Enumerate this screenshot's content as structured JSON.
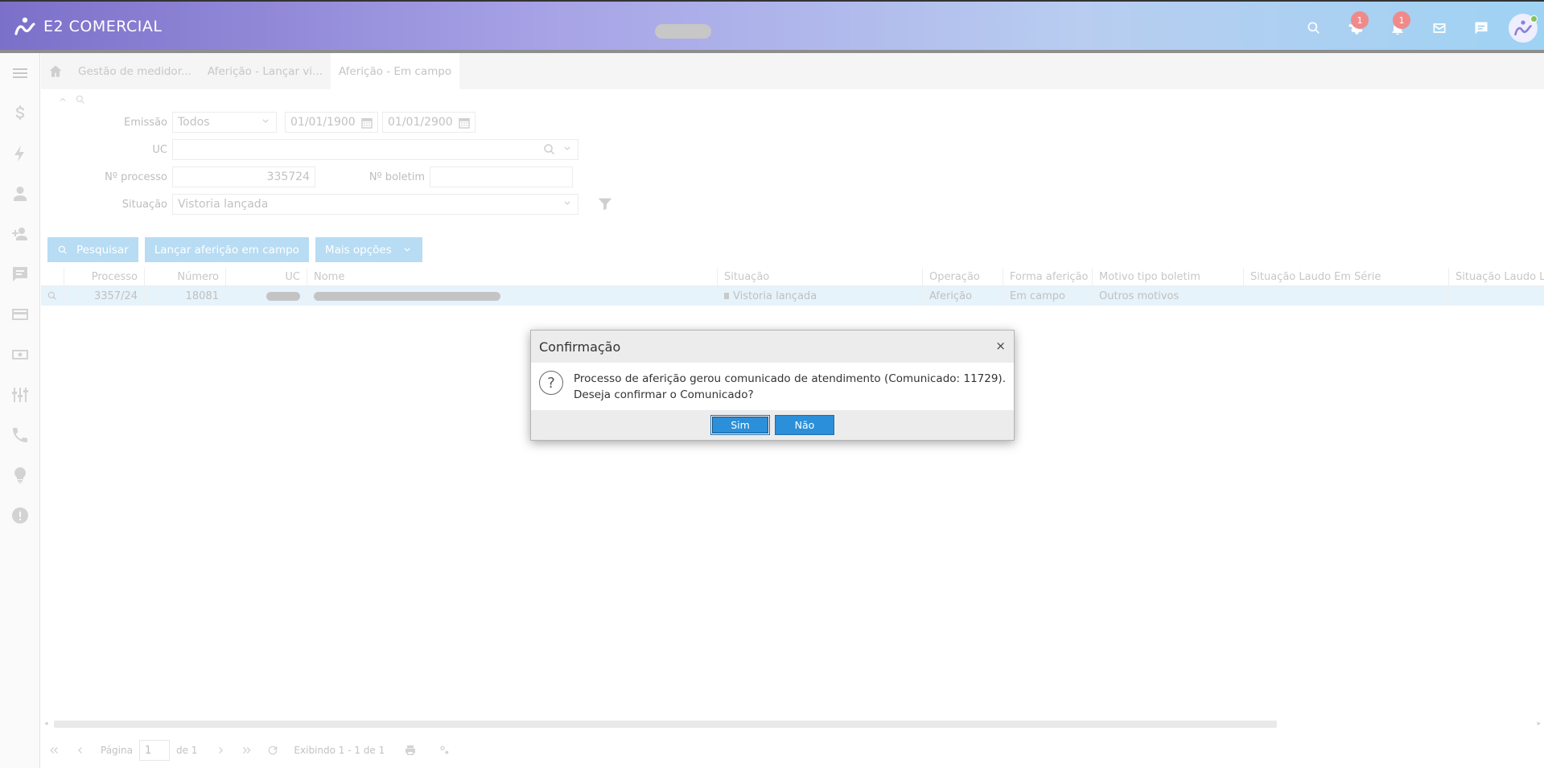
{
  "header": {
    "brand": "E2 COMERCIAL",
    "settings_badge": "1",
    "notifications_badge": "1",
    "icons": [
      "search-icon",
      "gear-icon",
      "bell-icon",
      "mail-icon",
      "chat-icon",
      "user-avatar-icon"
    ]
  },
  "sidebar": {
    "items": [
      "menu-icon",
      "dollar-icon",
      "bolt-icon",
      "user-icon",
      "user-plus-icon",
      "comment-icon",
      "credit-card-icon",
      "money-icon",
      "meters-icon",
      "phone-icon",
      "lightbulb-icon",
      "alert-icon"
    ]
  },
  "breadcrumbs": {
    "tabs": [
      "Gestão de medidor...",
      "Aferição - Lançar vi...",
      "Aferição - Em campo"
    ]
  },
  "filters": {
    "emissao_label": "Emissão",
    "emissao_value": "Todos",
    "date_from": "01/01/1900",
    "date_to": "01/01/2900",
    "uc_label": "UC",
    "processo_label": "Nº processo",
    "processo_value": "335724",
    "boletim_label": "Nº boletim",
    "boletim_value": "",
    "situacao_label": "Situação",
    "situacao_value": "Vistoria lançada"
  },
  "actions": {
    "search": "Pesquisar",
    "launch": "Lançar aferição em campo",
    "more": "Mais opções"
  },
  "grid": {
    "columns": [
      "Processo",
      "Número",
      "UC",
      "Nome",
      "Situação",
      "Operação",
      "Forma aferição",
      "Motivo tipo boletim",
      "Situação Laudo Em Série",
      "Situação Laudo Lab"
    ],
    "row": {
      "processo": "3357/24",
      "numero": "18081",
      "situacao": "Vistoria lançada",
      "operacao": "Aferição",
      "forma": "Em campo",
      "motivo": "Outros motivos"
    }
  },
  "pager": {
    "page_label": "Página",
    "page_value": "1",
    "of_label": "de 1",
    "showing": "Exibindo 1 - 1 de 1"
  },
  "dialog": {
    "title": "Confirmação",
    "close": "×",
    "message": "Processo de aferição gerou comunicado de atendimento (Comunicado: 11729). Deseja confirmar o Comunicado?",
    "yes": "Sim",
    "no": "Não"
  },
  "colors": {
    "accent": "#2b8fd9",
    "button_faded": "#b7dcf3",
    "row_selected": "#e6f3fb",
    "badge": "#f08a8a"
  }
}
